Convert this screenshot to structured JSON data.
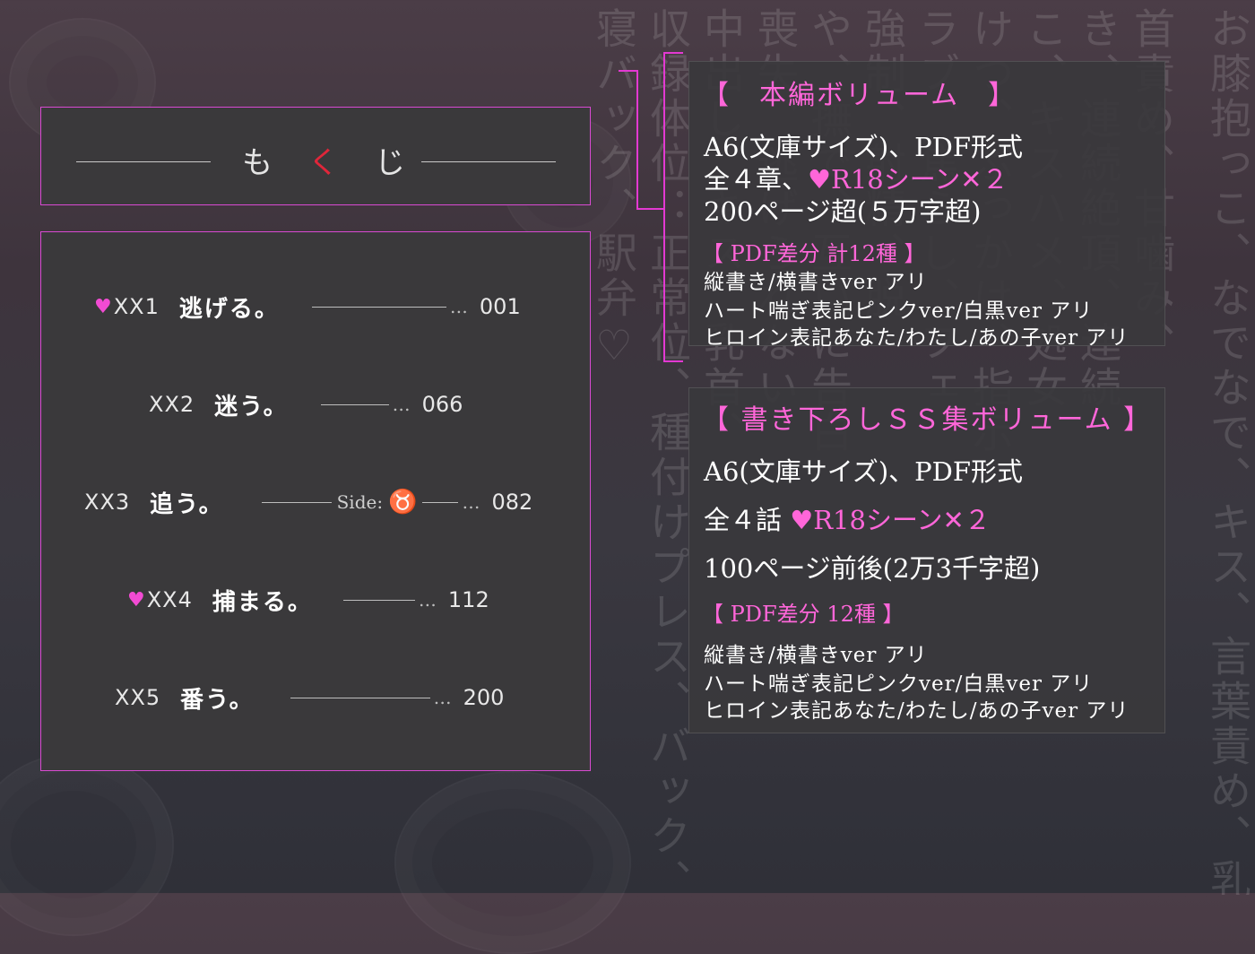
{
  "background": {
    "columns": [
      "寝バック、駅弁♡",
      "収録体位：正常位、種付けプレス、バック、",
      "中出し、キス、乳首、",
      "喪失、逃げられない",
      "や、撫で、互いに告白",
      "強制、射精、脱",
      "ラブ、焦らし、フェ",
      "けつ、ぶっかけ、指示",
      "こ、キスハメ、処女",
      "き、連続絶頂、連続",
      "首責め、甘噛み、",
      "お膝抱っこ、なでなで、キス、言葉責め、乳"
    ]
  },
  "title": {
    "text": "もくじ"
  },
  "toc": [
    {
      "heart": true,
      "code": "ⅩⅩ1",
      "title": "逃げる。",
      "page": "001",
      "side": ""
    },
    {
      "heart": false,
      "code": "ⅩⅩ2",
      "title": "迷う。",
      "page": "066",
      "side": ""
    },
    {
      "heart": false,
      "code": "ⅩⅩ3",
      "title": "追う。",
      "page": "082",
      "side": "Side:"
    },
    {
      "heart": true,
      "code": "ⅩⅩ4",
      "title": "捕まる。",
      "page": "112",
      "side": ""
    },
    {
      "heart": false,
      "code": "ⅩⅩ5",
      "title": "番う。",
      "page": "200",
      "side": ""
    }
  ],
  "main_volume": {
    "heading": "【　本編ボリューム　】",
    "format": "A6(文庫サイズ)、PDF形式",
    "chapters_prefix": "全４章、",
    "scenes": "R18シーン✕２",
    "pages": "200ページ超(５万字超)",
    "diff_heading": "【 PDF差分 計12種 】",
    "diff_items": [
      "縦書き/横書きver アリ",
      "ハート喘ぎ表記ピンクver/白黒ver アリ",
      "ヒロイン表記あなた/わたし/あの子ver アリ"
    ]
  },
  "ss_volume": {
    "heading": "【 書き下ろしＳＳ集ボリューム 】",
    "format": "A6(文庫サイズ)、PDF形式",
    "chapters_prefix": "全４話 ",
    "scenes": "R18シーン✕２",
    "pages": "100ページ前後(2万3千字超)",
    "diff_heading": "【 PDF差分 12種 】",
    "diff_items": [
      "縦書き/横書きver アリ",
      "ハート喘ぎ表記ピンクver/白黒ver アリ",
      "ヒロイン表記あなた/わたし/あの子ver アリ"
    ]
  },
  "colors": {
    "accent_pink": "#ff66d9",
    "border_pink": "#d94ad2",
    "taurus_red": "#e0263a"
  },
  "icons": {
    "heart": "heart-icon",
    "taurus": "taurus-icon"
  }
}
